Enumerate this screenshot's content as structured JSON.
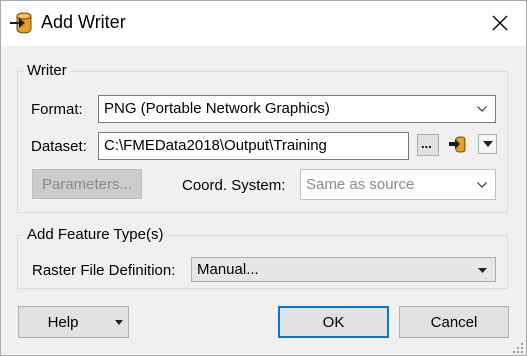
{
  "window": {
    "title": "Add Writer"
  },
  "writer_group": {
    "title": "Writer",
    "format_label": "Format:",
    "format_value": "PNG (Portable Network Graphics)",
    "dataset_label": "Dataset:",
    "dataset_value": "C:\\FMEData2018\\Output\\Training",
    "browse_label": "...",
    "parameters_label": "Parameters...",
    "coord_label": "Coord. System:",
    "coord_value": "Same as source"
  },
  "feature_group": {
    "title": "Add Feature Type(s)",
    "raster_label": "Raster File Definition:",
    "raster_value": "Manual..."
  },
  "footer": {
    "help_label": "Help",
    "ok_label": "OK",
    "cancel_label": "Cancel"
  },
  "colors": {
    "accent": "#0078d7",
    "dialog_bg": "#f0f0f0",
    "disabled_text": "#8a8a8a"
  },
  "icons": {
    "title": "fme-writer-icon",
    "close": "close-icon",
    "dataset_picker": "file-picker-icon",
    "dropdown": "chevron-down-icon"
  }
}
